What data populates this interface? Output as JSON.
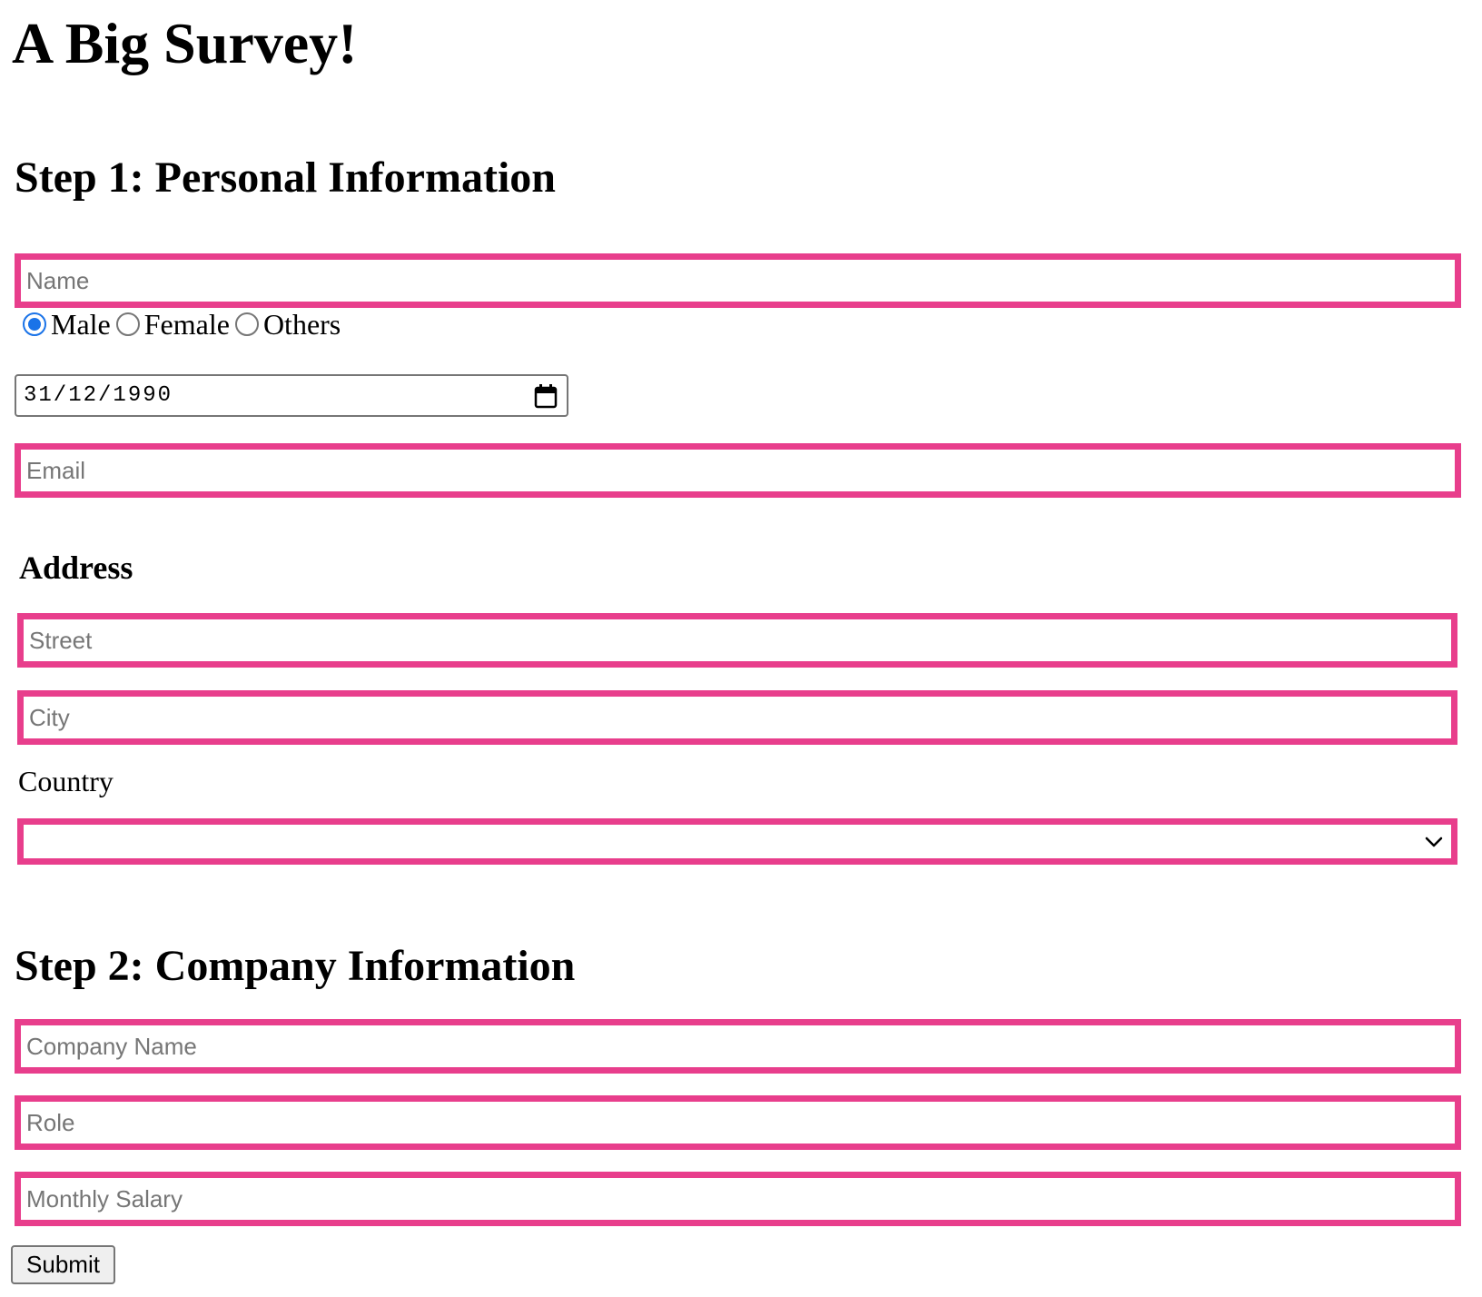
{
  "page": {
    "title": "A Big Survey!"
  },
  "step1": {
    "title": "Step 1: Personal Information",
    "name_placeholder": "Name",
    "gender": {
      "options": [
        "Male",
        "Female",
        "Others"
      ],
      "selected": "Male"
    },
    "birth_date": "31/12/1990",
    "email_placeholder": "Email"
  },
  "address": {
    "title": "Address",
    "street_placeholder": "Street",
    "city_placeholder": "City",
    "country_label": "Country",
    "country_value": ""
  },
  "step2": {
    "title": "Step 2: Company Information",
    "company_placeholder": "Company Name",
    "role_placeholder": "Role",
    "salary_placeholder": "Monthly Salary"
  },
  "submit_label": "Submit",
  "colors": {
    "field_border": "#e83e8c",
    "radio_accent": "#1a73e8",
    "placeholder_text": "#767676"
  },
  "icons": {
    "date_picker": "calendar-icon",
    "select_arrow": "chevron-down-icon"
  }
}
